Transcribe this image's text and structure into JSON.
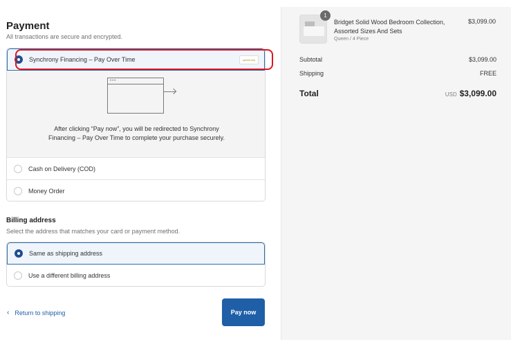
{
  "payment": {
    "title": "Payment",
    "subtitle": "All transactions are secure and encrypted.",
    "options": [
      {
        "label": "Synchrony Financing – Pay Over Time",
        "selected": true,
        "logo": "synchrony"
      },
      {
        "label": "Cash on Delivery (COD)",
        "selected": false
      },
      {
        "label": "Money Order",
        "selected": false
      }
    ],
    "redirect_text": "After clicking “Pay now”, you will be redirected to Synchrony Financing – Pay Over Time to complete your purchase securely."
  },
  "billing": {
    "title": "Billing address",
    "subtitle": "Select the address that matches your card or payment method.",
    "options": [
      {
        "label": "Same as shipping address",
        "selected": true
      },
      {
        "label": "Use a different billing address",
        "selected": false
      }
    ]
  },
  "footer": {
    "return_label": "Return to shipping",
    "pay_label": "Pay now"
  },
  "summary": {
    "item": {
      "quantity": "1",
      "name": "Bridget Solid Wood Bedroom Collection, Assorted Sizes And Sets",
      "variant": "Queen / 4 Piece",
      "price": "$3,099.00"
    },
    "subtotal_label": "Subtotal",
    "subtotal_value": "$3,099.00",
    "shipping_label": "Shipping",
    "shipping_value": "FREE",
    "total_label": "Total",
    "currency": "USD",
    "total_value": "$3,099.00"
  },
  "colors": {
    "accent": "#1f5fa8",
    "selected_radio": "#1f4f8f",
    "annotation": "#e0141e"
  },
  "icons": [
    "radio-icon",
    "synchrony-logo",
    "browser-redirect-icon",
    "chevron-left-icon",
    "product-thumbnail"
  ]
}
